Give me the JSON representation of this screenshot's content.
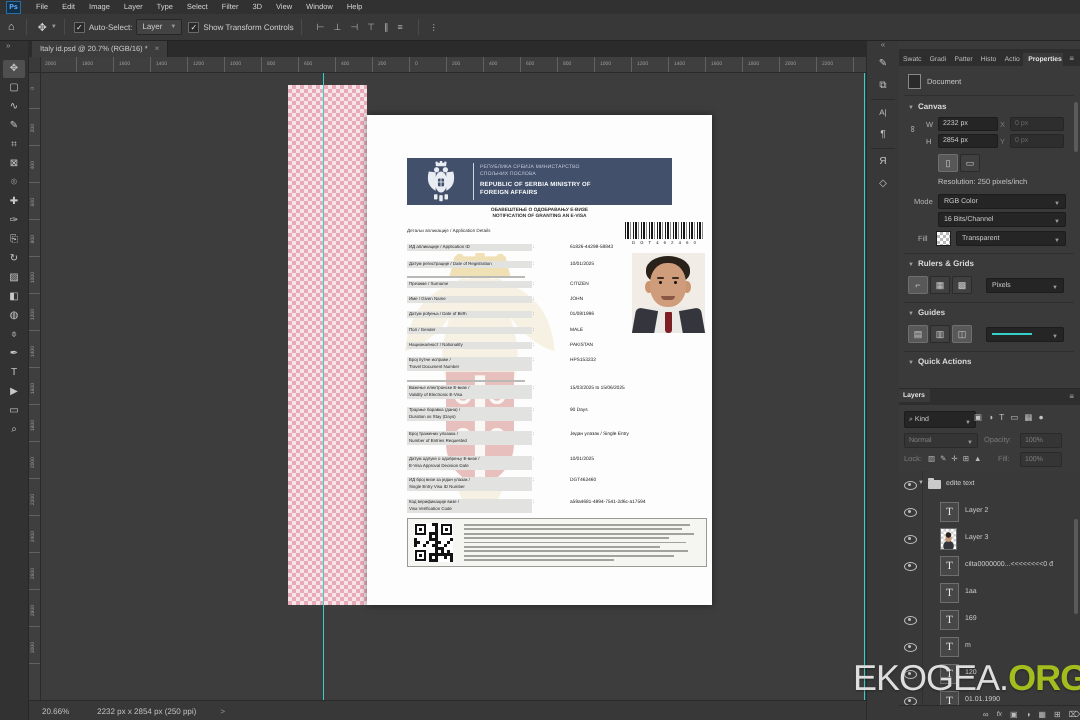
{
  "menu_bar": {
    "logo": "Ps",
    "items": [
      "File",
      "Edit",
      "Image",
      "Layer",
      "Type",
      "Select",
      "Filter",
      "3D",
      "View",
      "Window",
      "Help"
    ]
  },
  "options_bar": {
    "auto_select_label": "Auto-Select:",
    "auto_select_target": "Layer",
    "show_transform_label": "Show Transform Controls",
    "check": "✓"
  },
  "tab_bar": {
    "collapse_icon": "»",
    "title": "Italy id.psd @ 20.7% (RGB/16) *",
    "close": "×"
  },
  "rulers": {
    "top": [
      "2000",
      "1800",
      "1600",
      "1400",
      "1200",
      "1000",
      "800",
      "600",
      "400",
      "200",
      "0",
      "200",
      "400",
      "600",
      "800",
      "1000",
      "1200",
      "1400",
      "1600",
      "1800",
      "2000",
      "2200"
    ],
    "left": [
      "0",
      "200",
      "400",
      "600",
      "800",
      "1000",
      "1200",
      "1400",
      "1600",
      "1800",
      "2000",
      "2200",
      "2400",
      "2600",
      "2800",
      "3000"
    ]
  },
  "status_bar": {
    "zoom_level": "20.66%",
    "doc_info": "2232 px x 2854 px (250 ppi)",
    "chevron": ">"
  },
  "visa": {
    "ministry_cyr_line1": "РЕПУБЛИКА СРБИЈА МИНИСТАРСТВО",
    "ministry_cyr_line2": "СПОЉНИХ ПОСЛОВА",
    "ministry_en_line1": "REPUBLIC OF SERBIA MINISTRY OF",
    "ministry_en_line2": "FOREIGN AFFAIRS",
    "notification_title_cyr": "ОБАВЕШТЕЊЕ О ОДОБРАВАЊУ Е-ВИЗЕ",
    "notification_title_en": "NOTIFICATION OF GRANTING AN E-VISA",
    "barcode_value": "D G T 4 6 2 4 6 0",
    "section_header": "Детаљи апликације / Application Details",
    "fields": [
      {
        "label": "ИД апликације / Application ID",
        "value": "61826-44298-58843"
      },
      {
        "label": "Датум регистрације / Date of Registration",
        "value": "10/01/2025"
      },
      {
        "label": "Презиме / Surname",
        "value": "CITIZEN",
        "note": true
      },
      {
        "label": "Име / Given Name",
        "value": "JOHN"
      },
      {
        "label": "Датум рођења / Date of Birth",
        "value": "01/08/1996"
      },
      {
        "label": "Пол / Gender",
        "value": "MALE"
      },
      {
        "label": "Националност / Nationality",
        "value": "PAKISTAN"
      },
      {
        "label": "Број путне исправе /",
        "label2": "Travel Document Number",
        "value": "HPS153232"
      },
      {
        "label": "Важење електронске Е-визе /",
        "label2": "Validity of Electronic E-Visa",
        "value": "15/03/2025 to 15/06/2025",
        "note": true
      },
      {
        "label": "Трајање боравка (дана) /",
        "label2": "Duration os Stay (Days)",
        "value": "90 Days"
      },
      {
        "label": "Број тражених улазака /",
        "label2": "Number of Entries Requested",
        "value": "Један улазак /  Single Entry"
      },
      {
        "label": "Датум одлуке о одобрењу Е-визе /",
        "label2": "E-Visa Approval Decision Date",
        "value": "10/01/2025"
      },
      {
        "label": "ИД број визе за један улазак /",
        "label2": "Single Entry Visa ID Number",
        "value": "DGT462460"
      },
      {
        "label": "Код верификације визе /",
        "label2": "Visa Verification Code",
        "value": "a59a4681-4894-7541-2d6c-a17594"
      }
    ]
  },
  "collapsed_panels": {
    "expand_icon": "«"
  },
  "properties_panel": {
    "tabs": [
      "Swatc",
      "Gradi",
      "Patter",
      "Histo",
      "Actio",
      "Properties"
    ],
    "active_tab": "Properties",
    "document_label": "Document",
    "canvas": {
      "header": "Canvas",
      "w_label": "W",
      "w_value": "2232 px",
      "x_label": "X",
      "x_value": "0 px",
      "h_label": "H",
      "h_value": "2854 px",
      "y_label": "Y",
      "y_value": "0 px",
      "resolution": "Resolution: 250 pixels/inch",
      "mode_label": "Mode",
      "mode_value": "RGB Color",
      "bits_value": "16 Bits/Channel",
      "fill_label": "Fill",
      "fill_value": "Transparent"
    },
    "rulers_grids": {
      "header": "Rulers & Grids",
      "units_value": "Pixels"
    },
    "guides": {
      "header": "Guides"
    },
    "quick_actions": {
      "header": "Quick Actions"
    }
  },
  "layers_panel": {
    "tab": "Layers",
    "filter_label": "Kind",
    "blend_mode": "Normal",
    "opacity_label": "Opacity:",
    "opacity_value": "100%",
    "lock_label": "Lock:",
    "fill_label": "Fill:",
    "fill_value": "100%",
    "layers": [
      {
        "type": "group",
        "name": "edite text",
        "visible": true
      },
      {
        "type": "text",
        "name": "Layer 2",
        "visible": true
      },
      {
        "type": "image",
        "name": "Layer 3",
        "visible": true
      },
      {
        "type": "text",
        "name": "cilta0000000...<<<<<<<<0 đ",
        "visible": true
      },
      {
        "type": "text",
        "name": "1aa",
        "visible": false
      },
      {
        "type": "text",
        "name": "169",
        "visible": true
      },
      {
        "type": "text",
        "name": "m",
        "visible": true
      },
      {
        "type": "text",
        "name": "120",
        "visible": true
      },
      {
        "type": "text",
        "name": "01.01.1990",
        "visible": true
      }
    ]
  },
  "watermark": {
    "primary": "EKOGEA.",
    "accent": "ORG",
    "accent_color": "#a3bd1f"
  },
  "colors": {
    "guide": "#35d0ca",
    "banner_navy": "#42506b",
    "checker_pink": "#e7abb8"
  }
}
